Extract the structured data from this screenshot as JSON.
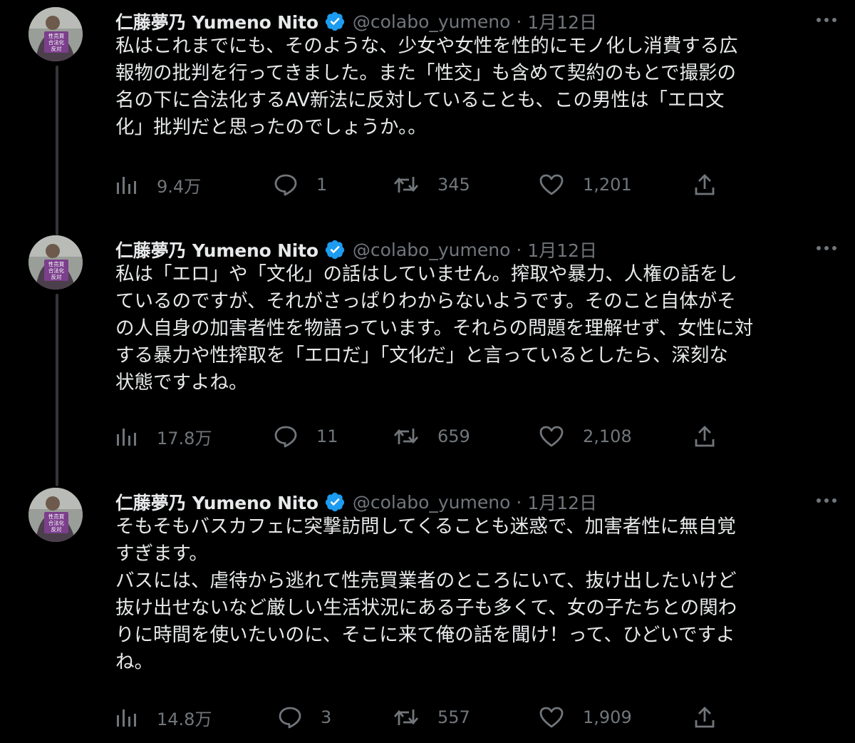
{
  "tweets": [
    {
      "author_name": "仁藤夢乃 Yumeno Nito",
      "handle": "@colabo_yumeno",
      "separator": "·",
      "date": "1月12日",
      "text": "私はこれまでにも、そのような、少女や女性を性的にモノ化し消費する広\n報物の批判を行ってきました。また「性交」も含めて契約のもとで撮影の\n名の下に合法化するAV新法に反対していることも、この男性は「エロ文\n化」批判だと思ったのでしょうか。。",
      "views": "9.4万",
      "replies": "1",
      "retweets": "345",
      "likes": "1,201",
      "avatar_sign": [
        "性売買",
        "合法化",
        "反対"
      ]
    },
    {
      "author_name": "仁藤夢乃 Yumeno Nito",
      "handle": "@colabo_yumeno",
      "separator": "·",
      "date": "1月12日",
      "text": "私は「エロ」や「文化」の話はしていません。搾取や暴力、人権の話をし\nているのですが、それがさっぱりわからないようです。そのこと自体がそ\nの人自身の加害者性を物語っています。それらの問題を理解せず、女性に対\nする暴力や性搾取を「エロだ」「文化だ」と言っているとしたら、深刻な\n状態ですよね。",
      "views": "17.8万",
      "replies": "11",
      "retweets": "659",
      "likes": "2,108",
      "avatar_sign": [
        "性売買",
        "合法化",
        "反対"
      ]
    },
    {
      "author_name": "仁藤夢乃 Yumeno Nito",
      "handle": "@colabo_yumeno",
      "separator": "·",
      "date": "1月12日",
      "text": "そもそもバスカフェに突撃訪問してくることも迷惑で、加害者性に無自覚\nすぎます。\nバスには、虐待から逃れて性売買業者のところにいて、抜け出したいけど\n抜け出せないなど厳しい生活状況にある子も多くて、女の子たちとの関わ\nりに時間を使いたいのに、そこに来て俺の話を聞け！って、ひどいですよ\nね。",
      "views": "14.8万",
      "replies": "3",
      "retweets": "557",
      "likes": "1,909",
      "avatar_sign": [
        "性売買",
        "合法化",
        "反対"
      ]
    }
  ],
  "icons": {
    "verified": "verified-badge-icon",
    "views": "bar-chart-icon",
    "reply": "speech-bubble-icon",
    "retweet": "retweet-arrows-icon",
    "like": "heart-icon",
    "share": "share-upload-icon",
    "more": "ellipsis-icon"
  },
  "colors": {
    "background": "#000000",
    "text": "#e7e9ea",
    "muted": "#71767b",
    "verified": "#1d9bf0",
    "thread_line": "#333639",
    "sign": "#7b3f8c"
  }
}
